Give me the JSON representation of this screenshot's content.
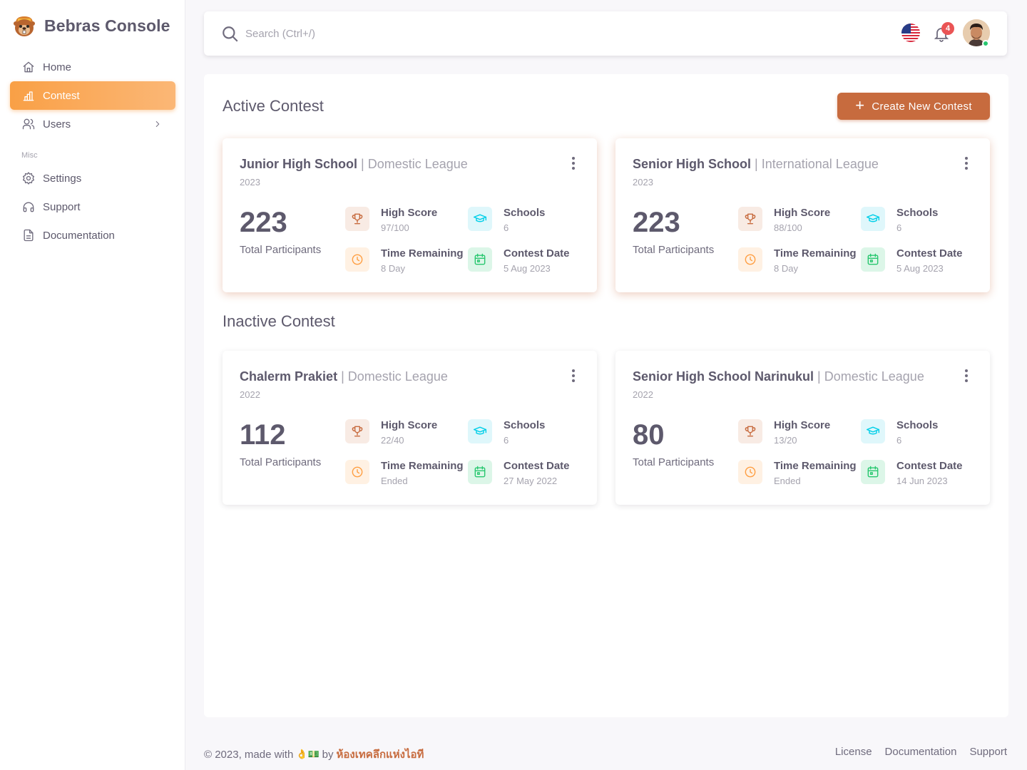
{
  "brand": {
    "name": "Bebras Console"
  },
  "sidebar": {
    "items": [
      {
        "label": "Home",
        "icon": "home-icon"
      },
      {
        "label": "Contest",
        "icon": "contest-icon",
        "active": true
      },
      {
        "label": "Users",
        "icon": "users-icon",
        "has_submenu": true
      }
    ],
    "misc_label": "Misc",
    "misc_items": [
      {
        "label": "Settings",
        "icon": "gear-icon"
      },
      {
        "label": "Support",
        "icon": "headphones-icon"
      },
      {
        "label": "Documentation",
        "icon": "document-icon"
      }
    ]
  },
  "navbar": {
    "search_placeholder": "Search (Ctrl+/)",
    "notification_count": "4",
    "language": "us-flag-icon"
  },
  "main": {
    "active_title": "Active Contest",
    "inactive_title": "Inactive Contest",
    "create_button": "Create New Contest",
    "active_contests": [
      {
        "name": "Junior High School",
        "separator": "|",
        "league": "Domestic League",
        "year": "2023",
        "participants": "223",
        "participants_label": "Total Participants",
        "high_score_label": "High Score",
        "high_score": "97/100",
        "schools_label": "Schools",
        "schools": "6",
        "time_label": "Time Remaining",
        "time": "8 Day",
        "date_label": "Contest Date",
        "date": "5 Aug 2023"
      },
      {
        "name": "Senior High School",
        "separator": "|",
        "league": "International League",
        "year": "2023",
        "participants": "223",
        "participants_label": "Total Participants",
        "high_score_label": "High Score",
        "high_score": "88/100",
        "schools_label": "Schools",
        "schools": "6",
        "time_label": "Time Remaining",
        "time": "8 Day",
        "date_label": "Contest Date",
        "date": "5 Aug 2023"
      }
    ],
    "inactive_contests": [
      {
        "name": "Chalerm Prakiet",
        "separator": "|",
        "league": "Domestic League",
        "year": "2022",
        "participants": "112",
        "participants_label": "Total Participants",
        "high_score_label": "High Score",
        "high_score": "22/40",
        "schools_label": "Schools",
        "schools": "6",
        "time_label": "Time Remaining",
        "time": "Ended",
        "date_label": "Contest Date",
        "date": "27 May 2022"
      },
      {
        "name": "Senior High School Narinukul",
        "separator": "|",
        "league": "Domestic League",
        "year": "2022",
        "participants": "80",
        "participants_label": "Total Participants",
        "high_score_label": "High Score",
        "high_score": "13/20",
        "schools_label": "Schools",
        "schools": "6",
        "time_label": "Time Remaining",
        "time": "Ended",
        "date_label": "Contest Date",
        "date": "14 Jun 2023"
      }
    ]
  },
  "footer": {
    "copyright": "© 2023, made with",
    "by": "by",
    "brand": "ห้องเทคลึกแห่งไอที",
    "links": [
      "License",
      "Documentation",
      "Support"
    ]
  },
  "colors": {
    "accent": "#c76b3e",
    "active_nav": "#f9a046",
    "badge": "#ea5455",
    "online": "#28c76f"
  }
}
